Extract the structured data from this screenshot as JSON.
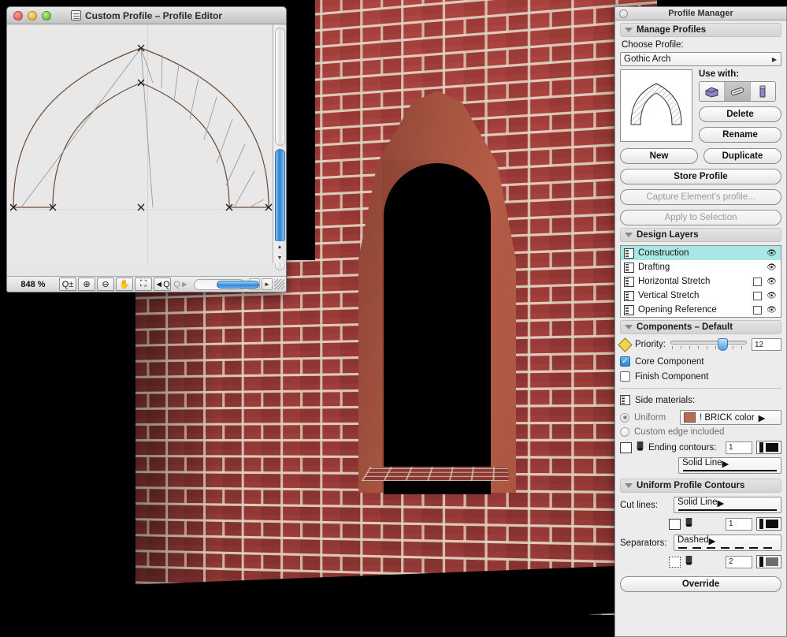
{
  "editor_window": {
    "title": "Custom Profile – Profile Editor",
    "icon": "profile-document-icon",
    "zoom_level": "848 %",
    "toolbar_icons": [
      "zoom-plusminus-icon",
      "zoom-in-icon",
      "zoom-out-icon",
      "pan-hand-icon",
      "zoom-fit-icon",
      "zoom-previous-icon",
      "zoom-next-icon"
    ],
    "traffic_lights": [
      "close",
      "minimize",
      "zoom"
    ]
  },
  "profile_manager": {
    "title": "Profile Manager",
    "sections": {
      "manage_profiles": {
        "header": "Manage Profiles",
        "choose_profile_label": "Choose Profile:",
        "selected_profile": "Gothic Arch",
        "use_with_label": "Use with:",
        "use_with_icons": [
          "wall-icon",
          "beam-icon",
          "column-icon"
        ],
        "use_with_selected_index": 1,
        "buttons": {
          "delete": "Delete",
          "rename": "Rename",
          "new": "New",
          "duplicate": "Duplicate",
          "store_profile": "Store Profile",
          "capture_element": "Capture Element's profile...",
          "apply_to_selection": "Apply to Selection"
        }
      },
      "design_layers": {
        "header": "Design Layers",
        "columns": [
          "icon",
          "name",
          "checkbox",
          "visibility"
        ],
        "rows": [
          {
            "name": "Construction",
            "selected": true,
            "has_checkbox": false,
            "checked": false,
            "visible": true
          },
          {
            "name": "Drafting",
            "selected": false,
            "has_checkbox": false,
            "checked": false,
            "visible": true
          },
          {
            "name": "Horizontal Stretch",
            "selected": false,
            "has_checkbox": true,
            "checked": false,
            "visible": true
          },
          {
            "name": "Vertical Stretch",
            "selected": false,
            "has_checkbox": true,
            "checked": false,
            "visible": true
          },
          {
            "name": "Opening Reference",
            "selected": false,
            "has_checkbox": true,
            "checked": false,
            "visible": true
          }
        ]
      },
      "components": {
        "header": "Components – Default",
        "priority_label": "Priority:",
        "priority_value": "12",
        "priority_percent": 62,
        "core_component_label": "Core Component",
        "core_component_checked": true,
        "finish_component_label": "Finish Component",
        "finish_component_checked": false,
        "side_materials_label": "Side materials:",
        "uniform_label": "Uniform",
        "uniform_selected": true,
        "material_value": "! BRICK color",
        "material_swatch": "#bd6a52",
        "custom_edge_label": "Custom edge included",
        "custom_edge_selected": false,
        "ending_contours_label": "Ending contours:",
        "ending_contours_pen": "1",
        "ending_contours_linetype": "Solid Line"
      },
      "uniform_profile_contours": {
        "header": "Uniform Profile Contours",
        "cut_lines_label": "Cut lines:",
        "cut_lines_type": "Solid Line",
        "cut_lines_pen": "1",
        "separators_label": "Separators:",
        "separators_type": "Dashed",
        "separators_pen": "2"
      }
    },
    "override_button": "Override"
  },
  "theme": {
    "selection_teal": "#a8e7e3",
    "brick_red": "#9e3f3c",
    "mortar": "#decdbc",
    "arch_terracotta": "#b05c45",
    "scrollbar_blue": "#2a7fd4"
  }
}
